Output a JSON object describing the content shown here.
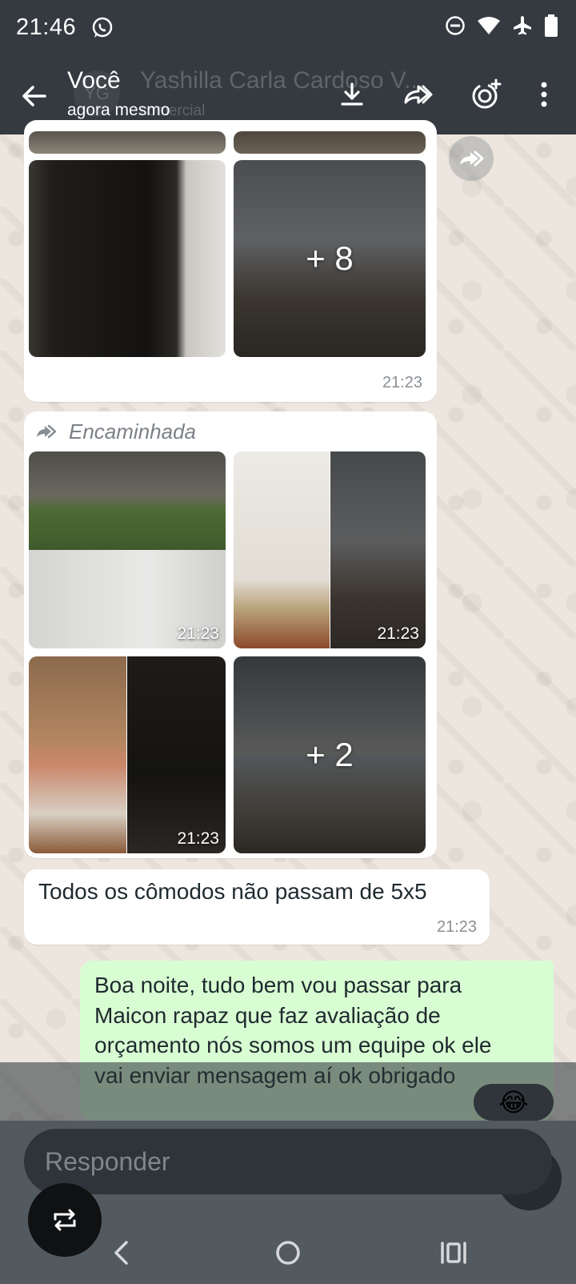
{
  "status_bar": {
    "time": "21:46"
  },
  "header": {
    "title": "Você",
    "subtitle": "agora mesmo",
    "ghost_avatar": "YG",
    "ghost_name": "Yashilla Carla Cardoso V...",
    "ghost_subtitle": "comercial"
  },
  "messages": {
    "album1": {
      "more_count": "+ 8",
      "time": "21:23"
    },
    "album2": {
      "forwarded_label": "Encaminhada",
      "tiles": [
        {
          "time": "21:23"
        },
        {
          "time": "21:23"
        },
        {
          "time": "21:23"
        },
        {
          "more_count": "+ 2"
        }
      ]
    },
    "text_in": {
      "text": "Todos os cômodos não passam de 5x5",
      "time": "21:23"
    },
    "text_out": {
      "text": "Boa noite, tudo bem vou passar para Maicon rapaz que faz avaliação de orçamento nós somos um equipe ok ele vai enviar mensagem aí ok obrigado"
    },
    "reaction_emoji": "😂"
  },
  "composer": {
    "placeholder": "Responder"
  },
  "icons": {
    "status": [
      "whatsapp-icon",
      "dnd-icon",
      "wifi-icon",
      "airplane-icon",
      "battery-icon"
    ],
    "header": [
      "back-icon",
      "download-icon",
      "forward-icon",
      "status-add-icon",
      "more-vert-icon"
    ],
    "nav": [
      "nav-back-icon",
      "nav-home-icon",
      "nav-recents-icon"
    ]
  },
  "colors": {
    "bar": "#343a40",
    "outgoing": "#d9fdd3",
    "incoming": "#ffffff",
    "wallpaper": "#ece6de"
  }
}
